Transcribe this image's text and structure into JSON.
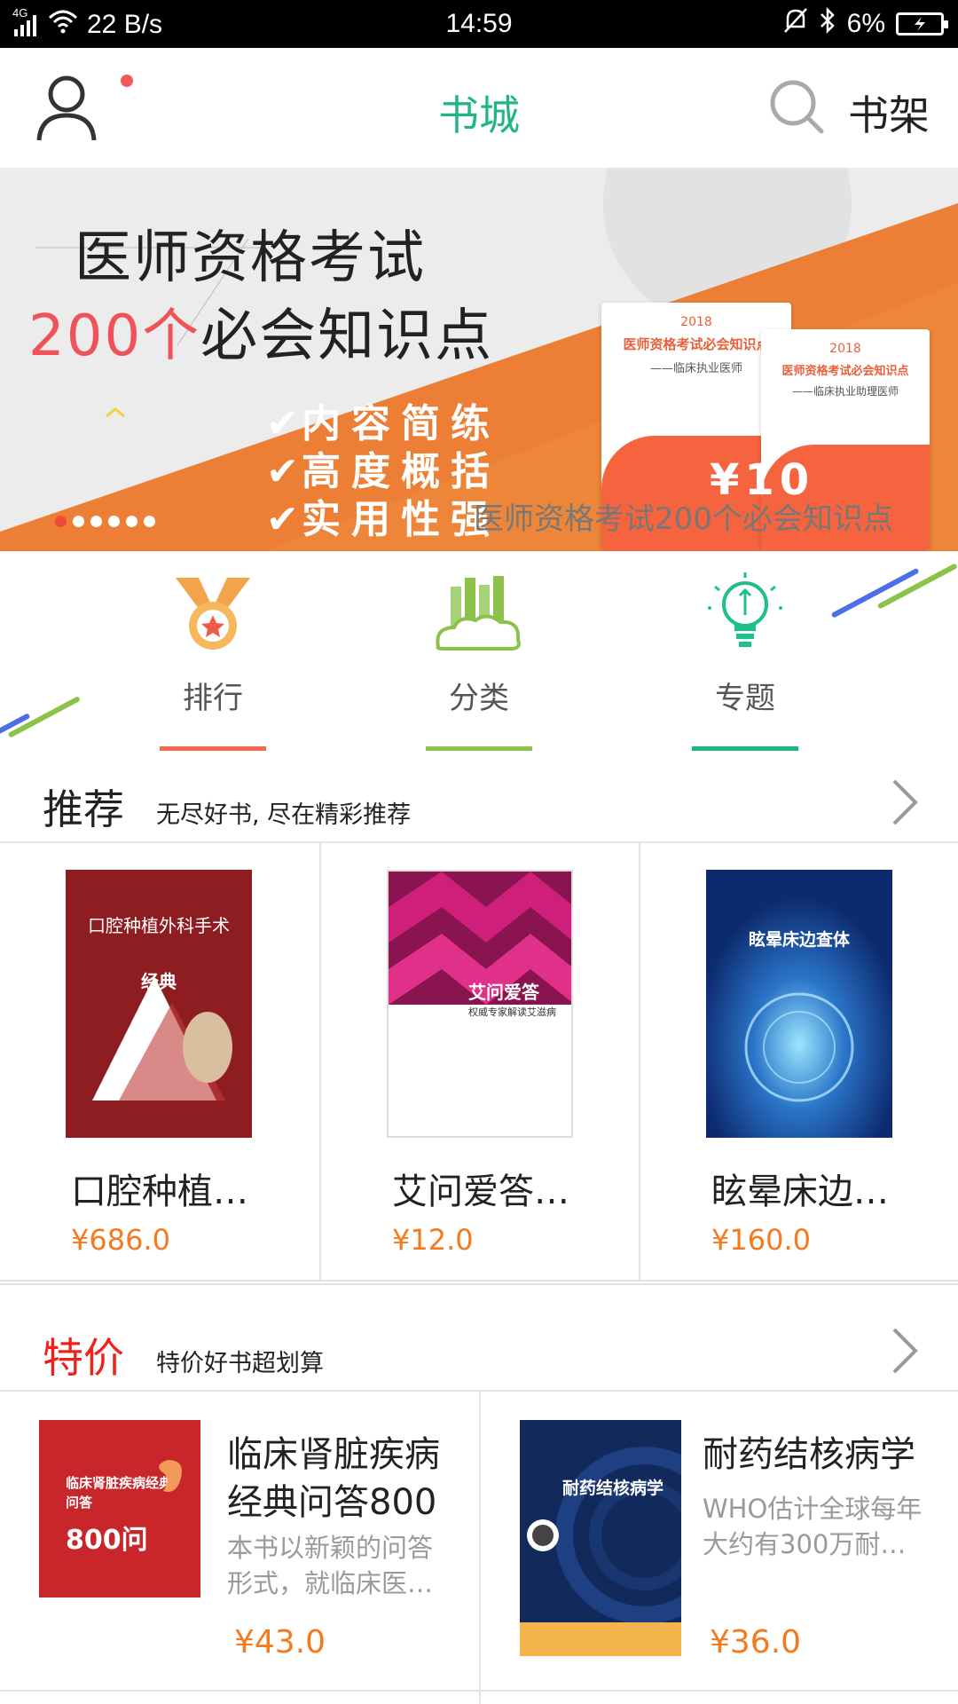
{
  "status_bar": {
    "network": "4G",
    "speed": "22 B/s",
    "time": "14:59",
    "battery": "6%"
  },
  "header": {
    "title": "书城",
    "shelf_label": "书架",
    "accent": "#20b681"
  },
  "banner": {
    "title_line1": "医师资格考试",
    "title_line2_num": "200个",
    "title_line2_rest": "必会知识点",
    "features": [
      "内容简练",
      "高度概括",
      "实用性强"
    ],
    "caption": "医师资格考试200个必会知识点",
    "price": "¥10",
    "book1": {
      "year": "2018",
      "title": "医师资格考试必会知识点",
      "subtitle": "——临床执业医师"
    },
    "book2": {
      "year": "2018",
      "title": "医师资格考试必会知识点",
      "subtitle": "——临床执业助理医师"
    },
    "page_count": 6,
    "active_page": 1
  },
  "categories": [
    {
      "label": "排行",
      "icon": "medal-icon",
      "color": "#f26b4f"
    },
    {
      "label": "分类",
      "icon": "cloud-books-icon",
      "color": "#8cc24a"
    },
    {
      "label": "专题",
      "icon": "lightbulb-icon",
      "color": "#20b681"
    }
  ],
  "recommend": {
    "title": "推荐",
    "subtitle": "无尽好书, 尽在精彩推荐",
    "books": [
      {
        "name": "口腔种植…",
        "price": "¥686.0",
        "cover_title": "口腔种植外科手术",
        "cover_tag": "经典"
      },
      {
        "name": "艾问爱答…",
        "price": "¥12.0",
        "cover_title": "艾问爱答",
        "cover_sub": "权威专家解读艾滋病"
      },
      {
        "name": "眩晕床边…",
        "price": "¥160.0",
        "cover_title": "眩晕床边查体"
      }
    ]
  },
  "special": {
    "title": "特价",
    "subtitle": "特价好书超划算",
    "title_color": "#f0201a",
    "books": [
      {
        "name": "临床肾脏疾病经典问答800",
        "desc": "本书以新颖的问答形式，就临床医…",
        "price": "¥43.0",
        "cover_title": "临床肾脏疾病经典问答",
        "cover_num": "800问"
      },
      {
        "name": "耐药结核病学",
        "desc": "WHO估计全球每年大约有300万耐…",
        "price": "¥36.0",
        "cover_title": "耐药结核病学"
      }
    ]
  }
}
